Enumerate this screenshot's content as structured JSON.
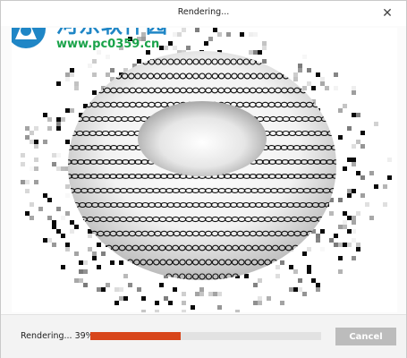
{
  "window": {
    "title": "Rendering..."
  },
  "watermark": {
    "cn": "河东软件园",
    "url": "www.pc0359.cn"
  },
  "progress": {
    "label": "Rendering... 39%",
    "value": 0.39
  },
  "buttons": {
    "cancel": "Cancel"
  },
  "colors": {
    "progress": "#d8461b",
    "cancel_bg": "#bcbcbc",
    "watermark_blue": "#1f86c6",
    "watermark_green": "#1aa34a"
  },
  "icons": {
    "close": "close-icon",
    "logo": "site-logo-icon"
  }
}
